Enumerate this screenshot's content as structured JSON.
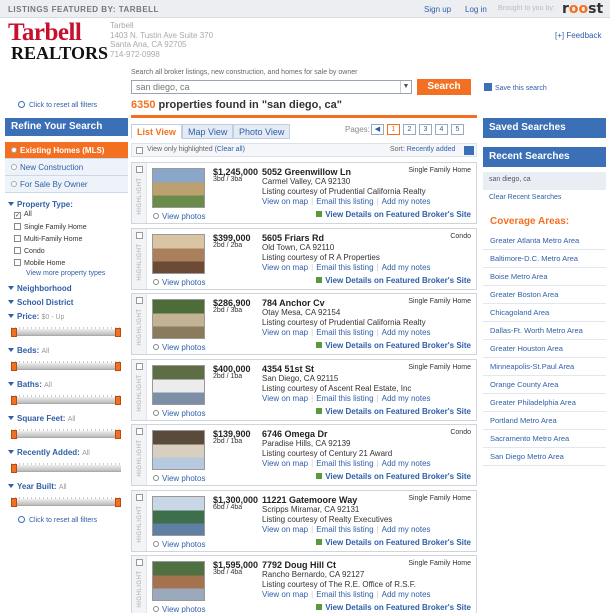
{
  "topbar": {
    "featured": "LISTINGS FEATURED BY: TARBELL",
    "signup": "Sign up",
    "login": "Log in",
    "brought_by": "Brought to you by:",
    "brand": "roost"
  },
  "header": {
    "logo_top": "Tarbell",
    "logo_bottom": "REALTORS",
    "address": [
      "Tarbell",
      "1403 N. Tustin Ave Suite 370",
      "Santa Ana, CA 92705",
      "714-972-0998"
    ],
    "feedback": "[+] Feedback"
  },
  "search": {
    "hint": "Search all broker listings, new construction, and homes for sale by owner",
    "value": "san diego, ca",
    "button": "Search",
    "save": "Save this search",
    "result_count": "6350",
    "result_text": " properties found in \"san diego, ca\""
  },
  "sidebar": {
    "reset": "Click to reset all filters",
    "refine": "Refine Your Search",
    "options": [
      "Existing Homes (MLS)",
      "New Construction",
      "For Sale By Owner"
    ],
    "ptype_label": "Property Type:",
    "ptypes": [
      "All",
      "Single Family Home",
      "Multi-Family Home",
      "Condo",
      "Mobile Home"
    ],
    "ptype_checked": "All",
    "more": "View more property types",
    "neighborhood": "Neighborhood",
    "school": "School District",
    "price": "Price:",
    "price_val": "$0 - Up",
    "beds": "Beds:",
    "beds_val": "All",
    "baths": "Baths:",
    "baths_val": "All",
    "sqft": "Square Feet:",
    "sqft_val": "All",
    "added": "Recently Added:",
    "added_val": "All",
    "year": "Year Built:",
    "year_val": "All"
  },
  "tabs": [
    "List View",
    "Map View",
    "Photo View"
  ],
  "pagination": {
    "label": "Pages:",
    "pages": [
      "1",
      "2",
      "3",
      "4",
      "5"
    ],
    "current": "1"
  },
  "listbar": {
    "only": "View only highlighted",
    "clear": "(Clear all)",
    "sort_label": "Sort:",
    "sort_value": "Recently added"
  },
  "card_labels": {
    "highlight": "HIGHLIGHT",
    "view_photos": "View photos",
    "map": "View on map",
    "email": "Email this listing",
    "notes": "Add my notes",
    "featured": "View Details on Featured Broker's Site"
  },
  "listings": [
    {
      "price": "$1,245,000",
      "bdba": "3bd / 3ba",
      "street": "5052 Greenwillow Ln",
      "city": "Carmel Valley, CA 92130",
      "courtesy": "Listing courtesy of Prudential California Realty",
      "type": "Single Family Home"
    },
    {
      "price": "$399,000",
      "bdba": "2bd / 2ba",
      "street": "5605 Friars Rd",
      "city": "Old Town, CA 92110",
      "courtesy": "Listing courtesy of R A Properties",
      "type": "Condo"
    },
    {
      "price": "$286,900",
      "bdba": "2bd / 3ba",
      "street": "784 Anchor Cv",
      "city": "Otay Mesa, CA 92154",
      "courtesy": "Listing courtesy of Prudential California Realty",
      "type": "Single Family Home"
    },
    {
      "price": "$400,000",
      "bdba": "2bd / 1ba",
      "street": "4354 51st St",
      "city": "San Diego, CA 92115",
      "courtesy": "Listing courtesy of Ascent Real Estate, Inc",
      "type": "Single Family Home"
    },
    {
      "price": "$139,900",
      "bdba": "2bd / 1ba",
      "street": "6746 Omega Dr",
      "city": "Paradise Hills, CA 92139",
      "courtesy": "Listing courtesy of Century 21 Award",
      "type": "Condo"
    },
    {
      "price": "$1,300,000",
      "bdba": "6bd / 4ba",
      "street": "11221 Gatemoore Way",
      "city": "Scripps Miramar, CA 92131",
      "courtesy": "Listing courtesy of Realty Executives",
      "type": "Single Family Home"
    },
    {
      "price": "$1,595,000",
      "bdba": "3bd / 4ba",
      "street": "7792 Doug Hill Ct",
      "city": "Rancho Bernardo, CA 92127",
      "courtesy": "Listing courtesy of The R.E. Office of R.S.F.",
      "type": "Single Family Home"
    }
  ],
  "right": {
    "saved": "Saved Searches",
    "recent": "Recent Searches",
    "recent_item": "san diego, ca",
    "clear_recent": "Clear Recent Searches",
    "coverage": "Coverage Areas:",
    "areas": [
      "Greater Atlanta Metro Area",
      "Baltimore-D.C. Metro Area",
      "Boise Metro Area",
      "Greater Boston Area",
      "Chicagoland Area",
      "Dallas-Ft. Worth Metro Area",
      "Greater Houston Area",
      "Minneapolis-St.Paul Area",
      "Orange County Area",
      "Greater Philadelphia Area",
      "Portland Metro Area",
      "Sacramento Metro Area",
      "San Diego Metro Area"
    ]
  },
  "colors": {
    "accent": "#f37022",
    "brand_blue": "#3b6fb6",
    "logo_red": "#c8102e"
  }
}
